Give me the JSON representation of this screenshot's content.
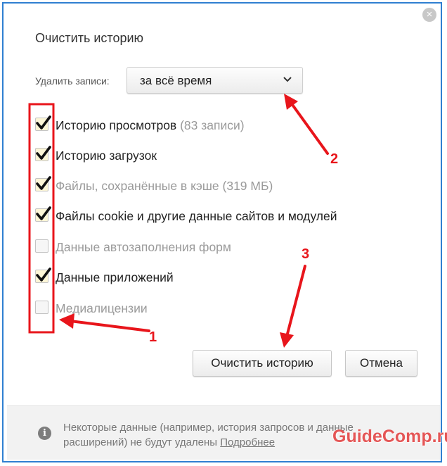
{
  "dialog": {
    "title": "Очистить историю",
    "close_label": "×",
    "range_label": "Удалить записи:",
    "range_value": "за всё время",
    "items": [
      {
        "label": "Историю просмотров",
        "count": "(83 записи)",
        "checked": true,
        "enabled": true
      },
      {
        "label": "Историю загрузок",
        "count": "",
        "checked": true,
        "enabled": true
      },
      {
        "label": "Файлы, сохранённые в кэше",
        "count": "(319 МБ)",
        "checked": true,
        "enabled": false
      },
      {
        "label": "Файлы cookie и другие данные сайтов и модулей",
        "count": "",
        "checked": true,
        "enabled": true
      },
      {
        "label": "Данные автозаполнения форм",
        "count": "",
        "checked": false,
        "enabled": false
      },
      {
        "label": "Данные приложений",
        "count": "",
        "checked": true,
        "enabled": true
      },
      {
        "label": "Медиалицензии",
        "count": "",
        "checked": false,
        "enabled": false
      }
    ],
    "clear_button": "Очистить историю",
    "cancel_button": "Отмена"
  },
  "footer": {
    "info_icon": "i",
    "note": "Некоторые данные (например, история запросов и данные расширений) не будут удалены",
    "more_link": "Подробнее"
  },
  "annotations": {
    "marker_1": "1",
    "marker_2": "2",
    "marker_3": "3",
    "color": "#e8151b"
  },
  "watermark": "GuideComp.ru"
}
